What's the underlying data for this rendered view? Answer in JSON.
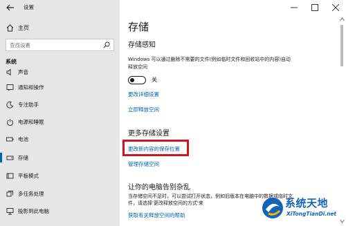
{
  "window": {
    "title": "设置"
  },
  "sidebar": {
    "home_label": "主页",
    "search_placeholder": "查找设置",
    "section_label": "系统",
    "items": [
      {
        "label": "声音",
        "icon": "speaker-icon"
      },
      {
        "label": "通知和操作",
        "icon": "notification-icon"
      },
      {
        "label": "专注助手",
        "icon": "moon-icon"
      },
      {
        "label": "电源和睡眠",
        "icon": "power-icon"
      },
      {
        "label": "电池",
        "icon": "battery-icon"
      },
      {
        "label": "存储",
        "icon": "storage-icon",
        "selected": true
      },
      {
        "label": "平板模式",
        "icon": "tablet-icon"
      },
      {
        "label": "多任务处理",
        "icon": "multitask-icon"
      },
      {
        "label": "投影到此电脑",
        "icon": "project-icon"
      }
    ]
  },
  "main": {
    "title": "存储",
    "storage_sense": {
      "heading": "存储感知",
      "description": "Windows 可以通过删除不需要的文件(例如临时文件和回收站中的内容)自动释放空间",
      "toggle_label": "关",
      "toggle_on": false,
      "links": [
        "更改详细设置",
        "立即释放空间"
      ]
    },
    "more_settings": {
      "heading": "更多存储设置",
      "links": [
        "更改新内容的保存位置",
        "管理存储空间"
      ]
    },
    "declutter": {
      "heading": "让你的电脑告别杂乱",
      "description": "当存储空间不足时，可以尝试打开状态，例如旧版本在电脑中的数据或临时文件，请选择'更改释放空间的方式'来",
      "link": "获取有关释放空间的帮助"
    }
  },
  "watermark": {
    "main": "系统天地",
    "sub": "XiTongTianDi.net"
  },
  "colors": {
    "accent": "#0063b1",
    "highlight": "#d3121e",
    "sidebar_bg": "#e6e6e6"
  }
}
